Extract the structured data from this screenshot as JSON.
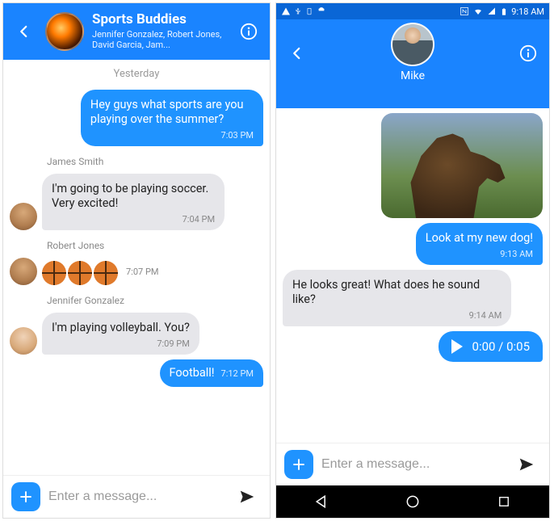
{
  "left": {
    "header": {
      "title": "Sports Buddies",
      "subtitle": "Jennifer Gonzalez, Robert Jones, David Garcia, Jam..."
    },
    "day_label": "Yesterday",
    "messages": [
      {
        "type": "sent",
        "text": "Hey guys what sports are you playing over the summer?",
        "time": "7:03 PM"
      },
      {
        "type": "received",
        "sender": "James Smith",
        "text": "I'm going to be playing soccer. Very excited!",
        "time": "7:04 PM"
      },
      {
        "type": "received-emoji",
        "sender": "Robert Jones",
        "count": 3,
        "time": "7:07 PM"
      },
      {
        "type": "received",
        "sender": "Jennifer Gonzalez",
        "text": "I'm playing volleyball. You?",
        "time": "7:09 PM"
      },
      {
        "type": "sent-inline",
        "text": "Football!",
        "time": "7:12 PM"
      }
    ],
    "composer_placeholder": "Enter a message..."
  },
  "right": {
    "status": {
      "time": "9:18 AM"
    },
    "header": {
      "name": "Mike"
    },
    "messages": [
      {
        "type": "image"
      },
      {
        "type": "sent",
        "text": "Look at my new dog!",
        "time": "9:13 AM"
      },
      {
        "type": "received",
        "text": "He looks great! What does he sound like?",
        "time": "9:14 AM"
      },
      {
        "type": "audio",
        "duration": "0:00 / 0:05"
      }
    ],
    "composer_placeholder": "Enter a message..."
  }
}
